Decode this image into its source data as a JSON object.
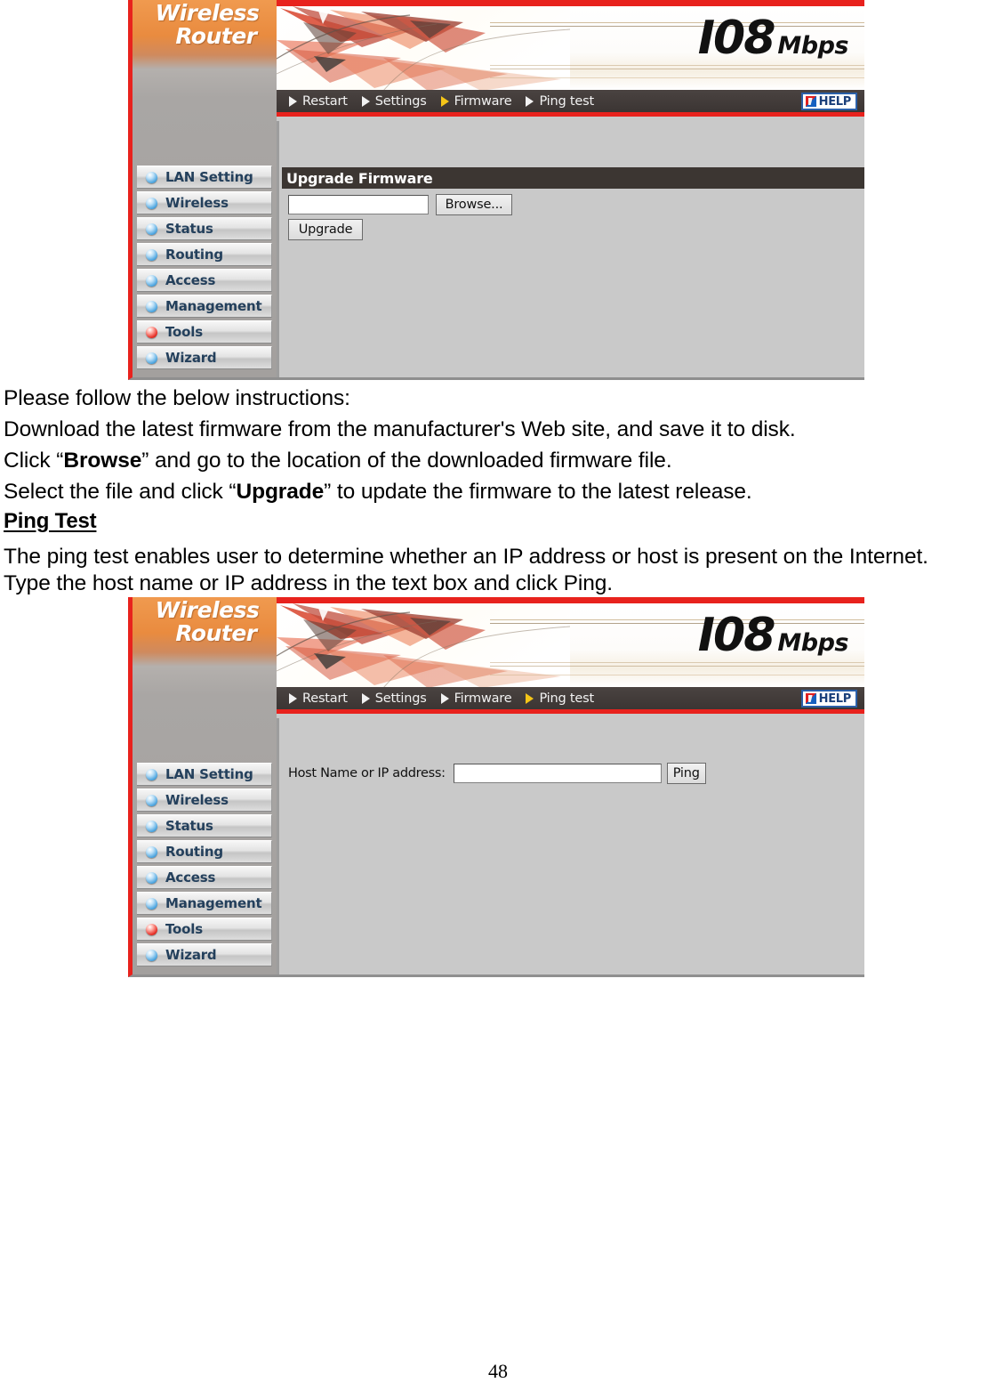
{
  "page": {
    "number": "48"
  },
  "panels": [
    {
      "name": "upgrade-firmware-panel",
      "logo": {
        "line1": "Wireless",
        "line2": "Router"
      },
      "banner": {
        "speed_number": "I08",
        "speed_unit": "Mbps"
      },
      "nav": {
        "items": [
          {
            "label": "Restart",
            "active": false
          },
          {
            "label": "Settings",
            "active": false
          },
          {
            "label": "Firmware",
            "active": true
          },
          {
            "label": "Ping test",
            "active": false
          }
        ],
        "help_label": "HELP"
      },
      "sidebar": {
        "items": [
          {
            "label": "LAN Setting",
            "bullet": "blue"
          },
          {
            "label": "Wireless",
            "bullet": "blue"
          },
          {
            "label": "Status",
            "bullet": "blue"
          },
          {
            "label": "Routing",
            "bullet": "blue"
          },
          {
            "label": "Access",
            "bullet": "blue"
          },
          {
            "label": "Management",
            "bullet": "blue"
          },
          {
            "label": "Tools",
            "bullet": "red"
          },
          {
            "label": "Wizard",
            "bullet": "blue"
          }
        ]
      },
      "content": {
        "section_title": "Upgrade Firmware",
        "file_value": "",
        "browse_label": "Browse...",
        "upgrade_label": "Upgrade"
      }
    },
    {
      "name": "ping-test-panel",
      "logo": {
        "line1": "Wireless",
        "line2": "Router"
      },
      "banner": {
        "speed_number": "I08",
        "speed_unit": "Mbps"
      },
      "nav": {
        "items": [
          {
            "label": "Restart",
            "active": false
          },
          {
            "label": "Settings",
            "active": false
          },
          {
            "label": "Firmware",
            "active": false
          },
          {
            "label": "Ping test",
            "active": true
          }
        ],
        "help_label": "HELP"
      },
      "sidebar": {
        "items": [
          {
            "label": "LAN Setting",
            "bullet": "blue"
          },
          {
            "label": "Wireless",
            "bullet": "blue"
          },
          {
            "label": "Status",
            "bullet": "blue"
          },
          {
            "label": "Routing",
            "bullet": "blue"
          },
          {
            "label": "Access",
            "bullet": "blue"
          },
          {
            "label": "Management",
            "bullet": "blue"
          },
          {
            "label": "Tools",
            "bullet": "red"
          },
          {
            "label": "Wizard",
            "bullet": "blue"
          }
        ]
      },
      "content": {
        "host_label": "Host Name or IP address:",
        "host_value": "",
        "ping_label": "Ping"
      }
    }
  ],
  "instructions": {
    "line_intro": "Please follow the below instructions:",
    "line_download": "Download the latest firmware from the manufacturer's Web site, and save it to disk.",
    "line_click_pre": "Click “",
    "line_click_bold": "Browse",
    "line_click_post": "” and go to the location of the downloaded firmware file.",
    "line_select_pre": "Select the file and click “",
    "line_select_bold": "Upgrade",
    "line_select_post": "” to update the firmware to the latest release."
  },
  "ping_section": {
    "heading": "Ping Test",
    "paragraph_line1": "The ping test enables user to determine whether an IP address or host is present on the Internet.",
    "paragraph_line2": "Type the host name or IP address in the text box and click Ping."
  }
}
